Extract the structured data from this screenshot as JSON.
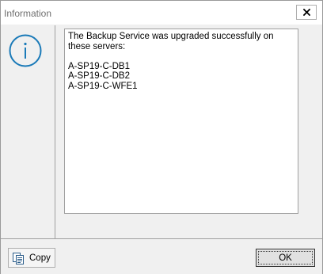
{
  "window": {
    "title": "Information"
  },
  "icons": {
    "main": "info-icon",
    "close": "close-icon",
    "copy": "copy-icon"
  },
  "colors": {
    "accent": "#1a7ab8",
    "title_text": "#707070"
  },
  "message": {
    "line1": "The Backup Service was upgraded successfully on",
    "line2": "these servers:",
    "servers": [
      "A-SP19-C-DB1",
      "A-SP19-C-DB2",
      "A-SP19-C-WFE1"
    ]
  },
  "footer": {
    "copy_label": "Copy",
    "ok_label": "OK"
  }
}
